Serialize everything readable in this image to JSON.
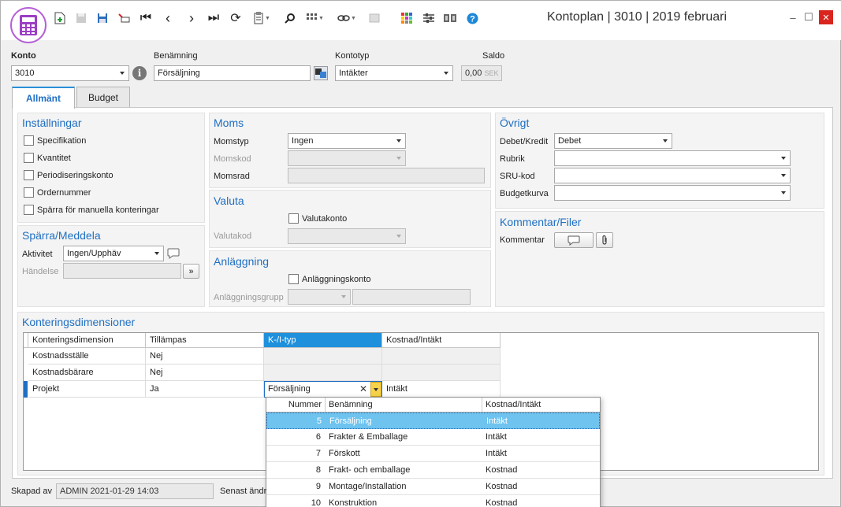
{
  "window": {
    "title": "Kontoplan | 3010 | 2019 februari",
    "controls": {
      "minimize": "–",
      "maximize": "☐",
      "close": "✕"
    }
  },
  "toolbar": {
    "icons": [
      "new-document-icon",
      "save-disabled-icon",
      "save-icon",
      "delete-icon",
      "first-record-icon",
      "previous-record-icon",
      "next-record-icon",
      "last-record-icon",
      "refresh-icon",
      "clipboard-paste-icon",
      "search-icon",
      "grid-columns-icon",
      "link-icon",
      "inactive-icon",
      "color-tiles-icon",
      "filter-settings-icon",
      "book-icon",
      "help-icon"
    ]
  },
  "header": {
    "konto_label": "Konto",
    "konto_value": "3010",
    "benamning_label": "Benämning",
    "benamning_value": "Försäljning",
    "kontotyp_label": "Kontotyp",
    "kontotyp_value": "Intäkter",
    "saldo_label": "Saldo",
    "saldo_value": "0,00",
    "saldo_currency": "SEK"
  },
  "tabs": [
    {
      "label": "Allmänt",
      "active": true
    },
    {
      "label": "Budget",
      "active": false
    }
  ],
  "installningar": {
    "title": "Inställningar",
    "options": [
      "Specifikation",
      "Kvantitet",
      "Periodiseringskonto",
      "Ordernummer",
      "Spärra för manuella konteringar"
    ]
  },
  "sparra": {
    "title": "Spärra/Meddela",
    "aktivitet_label": "Aktivitet",
    "aktivitet_value": "Ingen/Upphäv",
    "handelse_label": "Händelse"
  },
  "moms": {
    "title": "Moms",
    "momstyp_label": "Momstyp",
    "momstyp_value": "Ingen",
    "momskod_label": "Momskod",
    "momsrad_label": "Momsrad"
  },
  "valuta": {
    "title": "Valuta",
    "valutakonto_label": "Valutakonto",
    "valutakod_label": "Valutakod"
  },
  "anlaggning": {
    "title": "Anläggning",
    "anlaggningskonto_label": "Anläggningskonto",
    "anlaggningsgrupp_label": "Anläggningsgrupp"
  },
  "ovrigt": {
    "title": "Övrigt",
    "debetkredit_label": "Debet/Kredit",
    "debetkredit_value": "Debet",
    "rubrik_label": "Rubrik",
    "srukod_label": "SRU-kod",
    "budgetkurva_label": "Budgetkurva"
  },
  "kommentar": {
    "title": "Kommentar/Filer",
    "kommentar_label": "Kommentar"
  },
  "dimensioner": {
    "title": "Konteringsdimensioner",
    "columns": [
      "Konteringsdimension",
      "Tillämpas",
      "K-/I-typ",
      "Kostnad/Intäkt"
    ],
    "rows": [
      {
        "dimension": "Kostnadsställe",
        "tillampas": "Nej",
        "kityp": "",
        "kostnad": ""
      },
      {
        "dimension": "Kostnadsbärare",
        "tillampas": "Nej",
        "kityp": "",
        "kostnad": ""
      },
      {
        "dimension": "Projekt",
        "tillampas": "Ja",
        "kityp": "Försäljning",
        "kostnad": "Intäkt"
      }
    ]
  },
  "dropdown": {
    "columns": [
      "Nummer",
      "Benämning",
      "Kostnad/Intäkt"
    ],
    "rows": [
      {
        "nummer": "5",
        "benamning": "Försäljning",
        "typ": "Intäkt"
      },
      {
        "nummer": "6",
        "benamning": "Frakter & Emballage",
        "typ": "Intäkt"
      },
      {
        "nummer": "7",
        "benamning": "Förskott",
        "typ": "Intäkt"
      },
      {
        "nummer": "8",
        "benamning": "Frakt- och emballage",
        "typ": "Kostnad"
      },
      {
        "nummer": "9",
        "benamning": "Montage/Installation",
        "typ": "Kostnad"
      },
      {
        "nummer": "10",
        "benamning": "Konstruktion",
        "typ": "Kostnad"
      }
    ],
    "selected_index": 0
  },
  "footer": {
    "skapad_label": "Skapad av",
    "skapad_value": "ADMIN 2021-01-29 14:03",
    "senast_label": "Senast ändr"
  },
  "colors": {
    "accent": "#1f6fc2",
    "selected_header": "#1e90dc",
    "selected_row": "#6ec3ef",
    "logo_ring": "#b560d6"
  }
}
